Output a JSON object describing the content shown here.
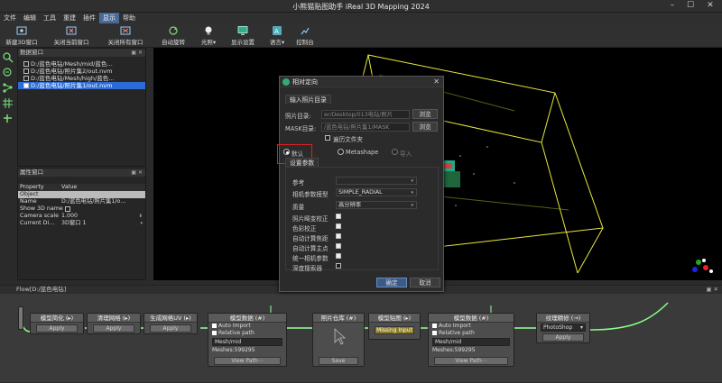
{
  "window": {
    "title": "小熊猫贴图助手 iReal 3D Mapping 2024"
  },
  "menu": [
    "文件",
    "编辑",
    "工具",
    "重建",
    "插件",
    "显示",
    "帮助"
  ],
  "menu_active_index": 5,
  "toolbar": {
    "new3d": "新建3D窗口",
    "close_current": "关闭当前窗口",
    "close_all": "关闭所有窗口",
    "auto_rotate": "自动旋转",
    "light": "光照",
    "display_settings": "显示设置",
    "language": "语言",
    "console": "控制台"
  },
  "data_panel": {
    "title": "数据窗口",
    "items": [
      {
        "label": "D:/蓝色电钻/Mesh/mid/蓝色…",
        "checked": false
      },
      {
        "label": "D:/蓝色电钻/照片集2/out.nvm",
        "checked": false
      },
      {
        "label": "D:/蓝色电钻/Mesh/high/蓝色…",
        "checked": false
      },
      {
        "label": "D:/蓝色电钻/照片集1/out.nvm",
        "checked": true,
        "selected": true
      }
    ]
  },
  "prop_panel": {
    "title": "属性窗口",
    "col_property": "Property",
    "col_value": "Value",
    "section": "Object",
    "rows": [
      {
        "k": "Name",
        "v": "D:/蓝色电钻/照片集1/o…"
      },
      {
        "k": "Show 3D name",
        "v": ""
      },
      {
        "k": "Camera scale",
        "v": "1.000"
      },
      {
        "k": "Current Di…",
        "v": "3D窗口 1"
      }
    ]
  },
  "flow": {
    "title": "Flow[D:/蓝色电钻]",
    "nodes": {
      "n1_title": "模型简化 (▸)",
      "n1_btn": "Apply",
      "n2_title": "清理网格 (▸)",
      "n2_btn": "Apply",
      "n3_title": "生成网格UV (▸)",
      "n3_btn": "Apply",
      "n4_title": "模型数据 (#)",
      "n4_auto": "Auto Import",
      "n4_rel": "Relative path",
      "n4_path": "Mesh/mid",
      "n4_meshes": "Meshes:599295",
      "n4_btn": "View Path⋯",
      "n5_title": "照片仓库 (#)",
      "n5_btn": "Save",
      "n6_title": "模型贴图 (▸)",
      "n6_btn": "Missing Input",
      "n7_title": "模型数据 (#)",
      "n7_auto": "Auto Import",
      "n7_rel": "Relative path",
      "n7_path": "Mesh/mid",
      "n7_meshes": "Meshes:599295",
      "n7_btn": "View Path⋯",
      "n8_title": "纹理精修 (→)",
      "n8_select": "PhotoShop",
      "n8_btn": "Apply"
    }
  },
  "dialog": {
    "title": "相对定向",
    "tab_input": "输入照片目录",
    "photo_dir_label": "照片目录:",
    "photo_dir_value": "er/Desktop/013电钻/照片",
    "mask_dir_label": "MASK目录:",
    "mask_dir_value": "/蓝色电钻/照片集1/MASK",
    "browse": "浏览",
    "traverse_label": "遍历文件夹",
    "radio_default": "默认",
    "radio_metashape": "Metashape",
    "radio_import": "导入",
    "tab_settings": "设置参数",
    "ref_label": "参考",
    "cam_model_label": "相机参数模型",
    "cam_model_value": "SIMPLE_RADIAL",
    "quality_label": "质量",
    "quality_value": "高分辨率",
    "checks": [
      {
        "label": "照片畸变校正",
        "on": true
      },
      {
        "label": "色彩校正",
        "on": true
      },
      {
        "label": "自动计算焦距",
        "on": true
      },
      {
        "label": "自动计算主点",
        "on": true
      },
      {
        "label": "统一相机参数",
        "on": true
      },
      {
        "label": "深度搜索器",
        "on": false
      }
    ],
    "ok": "确定",
    "cancel": "取消"
  }
}
